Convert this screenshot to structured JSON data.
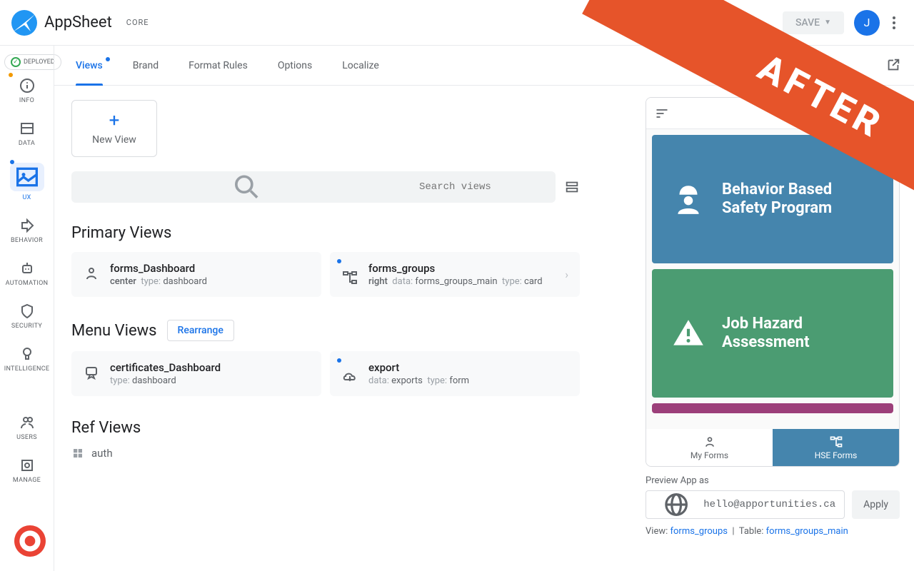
{
  "header": {
    "app_name": "AppSheet",
    "tier": "CORE",
    "save_label": "SAVE",
    "avatar_initial": "J"
  },
  "deployed_label": "DEPLOYED",
  "sidebar": {
    "items": [
      {
        "label": "INFO"
      },
      {
        "label": "DATA"
      },
      {
        "label": "UX"
      },
      {
        "label": "BEHAVIOR"
      },
      {
        "label": "AUTOMATION"
      },
      {
        "label": "SECURITY"
      },
      {
        "label": "INTELLIGENCE"
      },
      {
        "label": "USERS"
      },
      {
        "label": "MANAGE"
      }
    ]
  },
  "tabs": {
    "items": [
      "Views",
      "Brand",
      "Format Rules",
      "Options",
      "Localize"
    ]
  },
  "new_view_label": "New View",
  "search_placeholder": "Search views",
  "sections": {
    "primary": {
      "title": "Primary Views"
    },
    "menu": {
      "title": "Menu Views",
      "rearrange": "Rearrange"
    },
    "ref": {
      "title": "Ref Views",
      "group": "auth"
    }
  },
  "primary_views": [
    {
      "name": "forms_Dashboard",
      "pos": "center",
      "type_label": "type:",
      "type": "dashboard"
    },
    {
      "name": "forms_groups",
      "pos": "right",
      "data_label": "data:",
      "data": "forms_groups_main",
      "type_label": "type:",
      "type": "card"
    }
  ],
  "menu_views": [
    {
      "name": "certificates_Dashboard",
      "type_label": "type:",
      "type": "dashboard"
    },
    {
      "name": "export",
      "data_label": "data:",
      "data": "exports",
      "type_label": "type:",
      "type": "form"
    }
  ],
  "preview": {
    "cards": [
      {
        "title": "Behavior Based Safety Program"
      },
      {
        "title": "Job Hazard Assessment"
      }
    ],
    "tabs": [
      {
        "label": "My Forms"
      },
      {
        "label": "HSE Forms"
      }
    ],
    "footer_label": "Preview App as",
    "email": "hello@apportunities.ca",
    "apply": "Apply",
    "meta_view_label": "View:",
    "meta_view": "forms_groups",
    "meta_table_label": "Table:",
    "meta_table": "forms_groups_main"
  },
  "ribbon": "AFTER"
}
